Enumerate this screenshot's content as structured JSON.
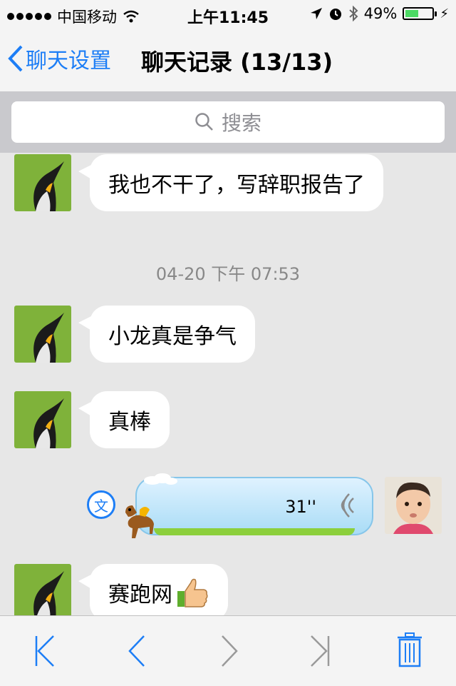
{
  "status_bar": {
    "carrier": "中国移动",
    "time": "上午11:45",
    "battery_percent": "49%",
    "battery_level": 0.49,
    "signal_icon": "signal-dots-icon",
    "wifi_icon": "wifi-icon",
    "location_icon": "location-arrow-icon",
    "alarm_icon": "alarm-icon",
    "bluetooth_icon": "bluetooth-icon"
  },
  "nav": {
    "back_label": "聊天设置",
    "title": "聊天记录 (13/13)"
  },
  "search": {
    "placeholder": "搜索"
  },
  "messages": [
    {
      "type": "text",
      "text": "我也不干了，写辞职报告了"
    },
    {
      "type": "time",
      "text": "04-20 下午 07:53"
    },
    {
      "type": "text",
      "text": "小龙真是争气"
    },
    {
      "type": "text",
      "text": "真棒"
    },
    {
      "type": "voice",
      "duration": "31''",
      "translate_label": "文"
    },
    {
      "type": "text",
      "text": "赛跑网",
      "emoji": "thumbs-up-icon"
    }
  ],
  "toolbar": {
    "first_icon": "first-page-icon",
    "prev_icon": "previous-page-icon",
    "next_icon": "next-page-icon",
    "last_icon": "last-page-icon",
    "delete_icon": "trash-icon"
  },
  "colors": {
    "accent": "#1d7ef6",
    "background": "#e7e7e7",
    "bubble": "#ffffff",
    "voice_bubble": "#a9dcf6"
  }
}
